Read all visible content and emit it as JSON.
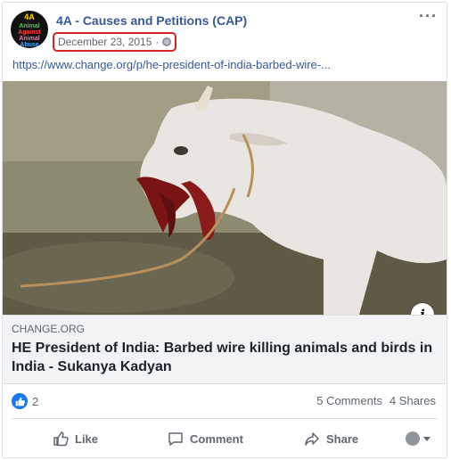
{
  "post": {
    "page_name": "4A - Causes and Petitions (CAP)",
    "avatar_lines": [
      "4A",
      "Animal",
      "Against",
      "Animal",
      "Abuse"
    ],
    "date": "December 23, 2015",
    "audience_icon": "globe-icon",
    "link_url": "https://www.change.org/p/he-president-of-india-barbed-wire-..."
  },
  "preview": {
    "domain": "CHANGE.ORG",
    "headline": "HE President of India: Barbed wire killing animals and birds in India - Sukanya Kadyan",
    "info_icon": "i"
  },
  "stats": {
    "like_count": "2",
    "comments": "5 Comments",
    "shares": "4 Shares"
  },
  "actions": {
    "like": "Like",
    "comment": "Comment",
    "share": "Share"
  },
  "colors": {
    "link": "#385898",
    "accent": "#1877f2",
    "highlight_border": "#d42424"
  }
}
